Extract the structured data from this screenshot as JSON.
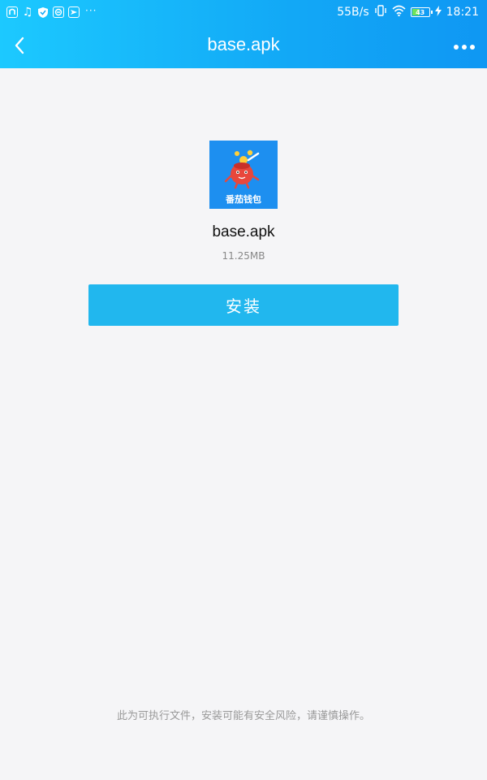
{
  "status_bar": {
    "net_speed": "55B/s",
    "battery_level": "43",
    "time": "18:21",
    "more_notifications": "···",
    "icons": [
      "app-notification-icon",
      "music-icon",
      "shield-icon",
      "security-app-icon",
      "messenger-icon",
      "vibrate-icon",
      "wifi-icon",
      "battery-icon",
      "charging-icon"
    ]
  },
  "toolbar": {
    "title": "base.apk",
    "back_icon": "chevron-left-icon",
    "more_icon": "more-horizontal-icon"
  },
  "file": {
    "app_icon_text": "番茄钱包",
    "name": "base.apk",
    "size": "11.25MB"
  },
  "actions": {
    "install_label": "安装"
  },
  "footer": {
    "warning": "此为可执行文件，安装可能有安全风险，请谨慎操作。"
  },
  "colors": {
    "header_gradient_start": "#1cc9ff",
    "header_gradient_end": "#0f97f3",
    "install_button": "#21b7ee",
    "background": "#f5f5f7",
    "app_icon_bg": "#1d8ff0"
  }
}
